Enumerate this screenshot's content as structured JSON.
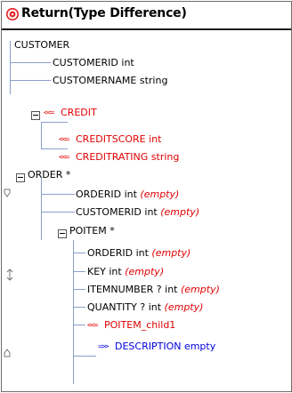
{
  "title": "Return(Type Difference)",
  "tree": {
    "customer": "CUSTOMER",
    "customer_id": "CUSTOMERID int",
    "customer_name": "CUSTOMERNAME string",
    "credit": "CREDIT",
    "credit_score": "CREDITSCORE int",
    "credit_rating": "CREDITRATING string",
    "order": "ORDER *",
    "order_id": "ORDERID int",
    "order_customer_id": "CUSTOMERID int",
    "poitem": "POITEM *",
    "poitem_order_id": "ORDERID int",
    "key": "KEY int",
    "item_number": "ITEMNUMBER ? int",
    "quantity": "QUANTITY ? int",
    "poitem_child": "POITEM_child1",
    "description": "DESCRIPTION empty",
    "empty_label": "(empty)",
    "arrow_left": "<<=",
    "arrow_right": "=>>"
  },
  "colors": {
    "added": "#e00000",
    "changed": "#0000e0",
    "title_icon": "#e02020"
  }
}
